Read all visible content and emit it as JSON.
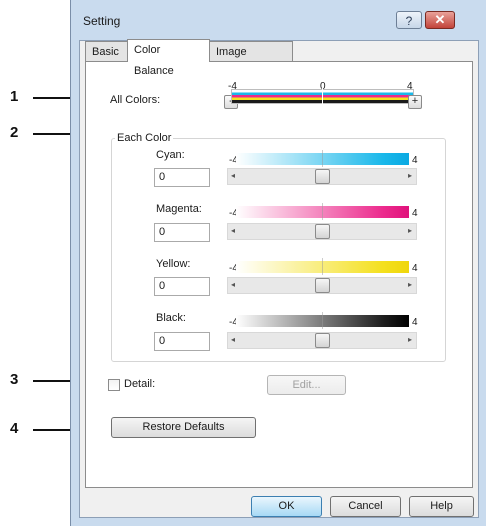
{
  "callouts": [
    "1",
    "2",
    "3",
    "4"
  ],
  "window": {
    "title": "Setting",
    "help_glyph": "?",
    "close_glyph": "✕"
  },
  "tabs": [
    {
      "label": "Basic"
    },
    {
      "label": "Color Balance",
      "active": true
    },
    {
      "label": "Image Attribute"
    }
  ],
  "all_colors": {
    "label": "All Colors:",
    "ticks": {
      "min": "-4",
      "mid": "0",
      "max": "4"
    },
    "minus_label": "-",
    "plus_label": "+"
  },
  "each_color": {
    "title": "Each Color",
    "channels": [
      {
        "label": "Cyan:",
        "value": "0",
        "min": "-4",
        "max": "4",
        "color": "#1ab8ea"
      },
      {
        "label": "Magenta:",
        "value": "0",
        "min": "-4",
        "max": "4",
        "color": "#ec2b8d"
      },
      {
        "label": "Yellow:",
        "value": "0",
        "min": "-4",
        "max": "4",
        "color": "#f4e01e"
      },
      {
        "label": "Black:",
        "value": "0",
        "min": "-4",
        "max": "4",
        "color": "#1e1e1e"
      }
    ],
    "arrow_left": "◂",
    "arrow_right": "▸"
  },
  "detail": {
    "label": "Detail:",
    "checked": false,
    "edit_label": "Edit..."
  },
  "restore_label": "Restore Defaults",
  "footer": {
    "ok": "OK",
    "cancel": "Cancel",
    "help": "Help"
  },
  "colors": {
    "accent": "#3c7fb1",
    "frame": "#c9dbee"
  }
}
